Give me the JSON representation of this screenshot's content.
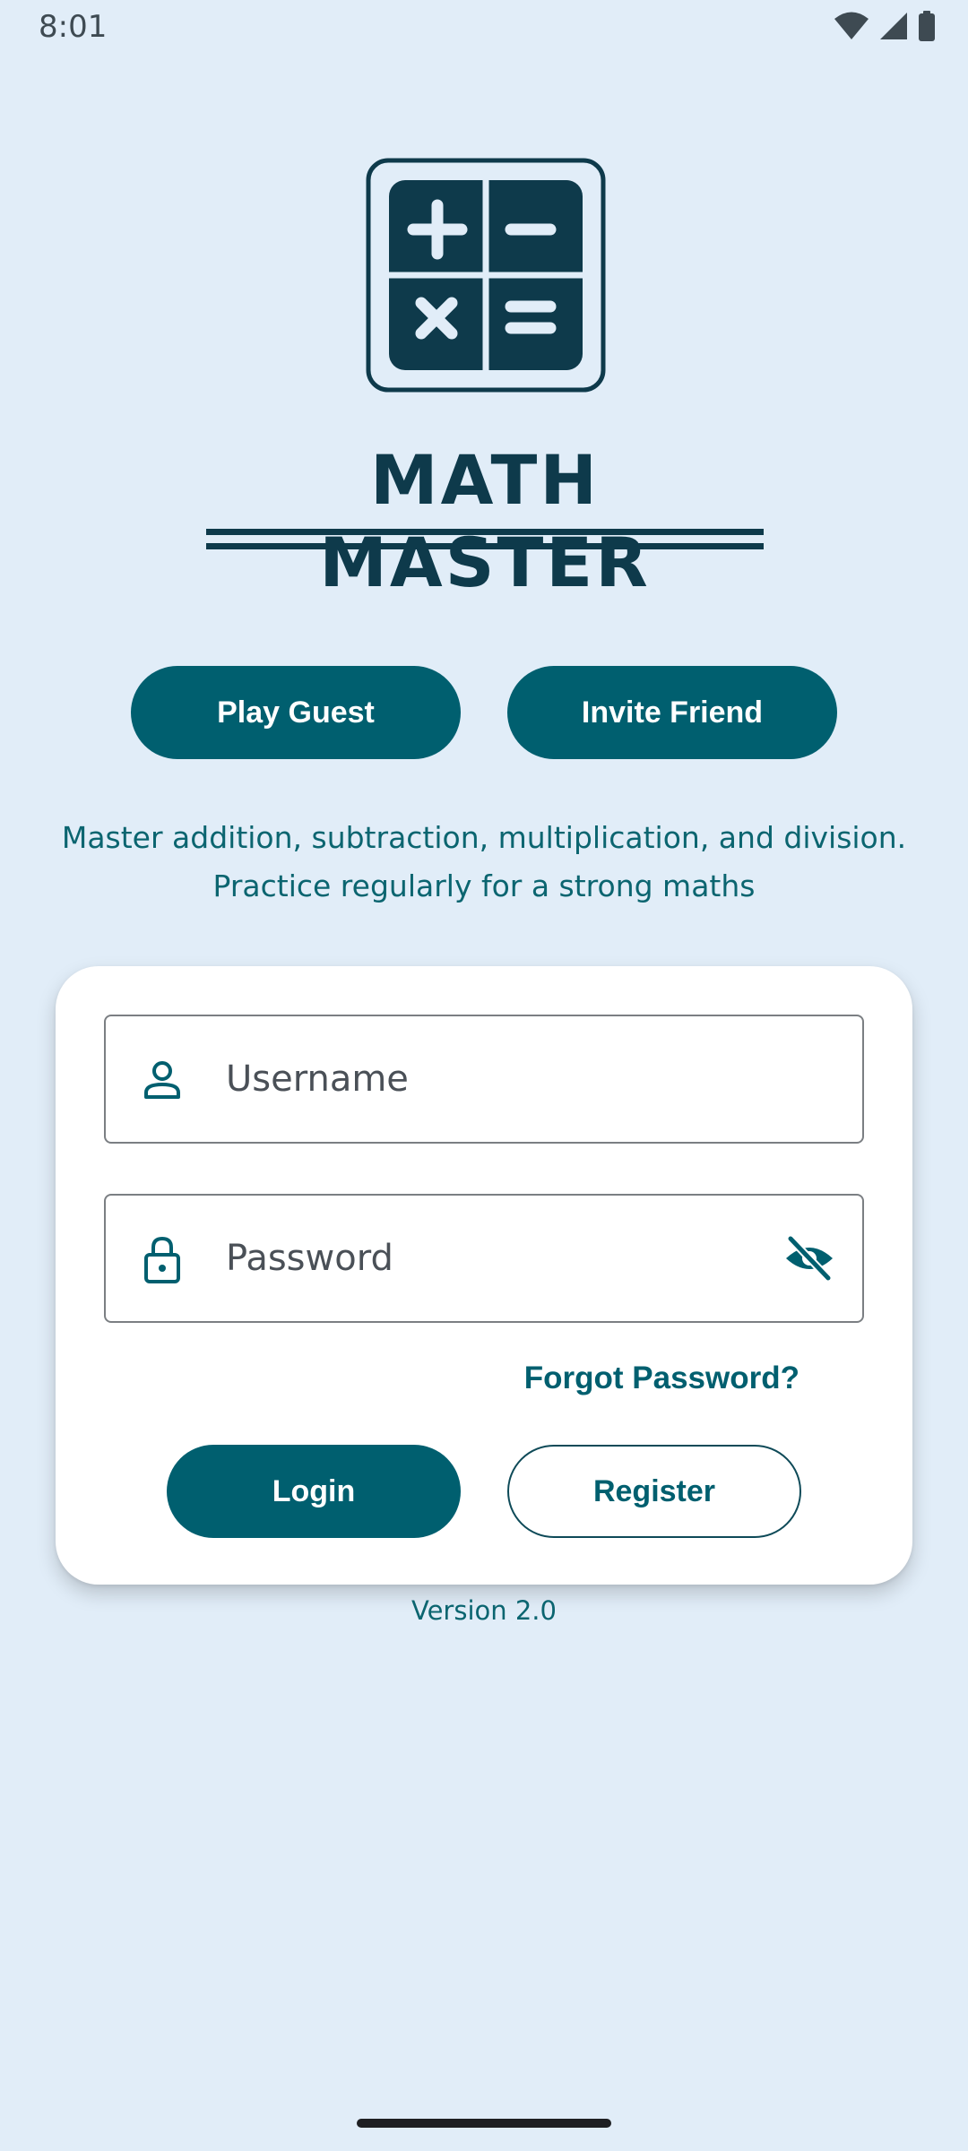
{
  "status_bar": {
    "time": "8:01",
    "icons": [
      "wifi-icon",
      "signal-icon",
      "battery-icon"
    ]
  },
  "app": {
    "title": "MATH MASTER",
    "logo_icon": "calculator-icon"
  },
  "top_actions": {
    "play_guest": "Play Guest",
    "invite_friend": "Invite Friend"
  },
  "tagline": {
    "line1": "Master addition, subtraction, multiplication, and division.",
    "line2": "Practice regularly for a strong maths"
  },
  "login_form": {
    "username": {
      "placeholder": "Username",
      "value": "",
      "icon": "person-icon"
    },
    "password": {
      "placeholder": "Password",
      "value": "",
      "icon": "lock-icon",
      "toggle_icon": "visibility-off-icon"
    },
    "forgot_password": "Forgot Password?",
    "login_label": "Login",
    "register_label": "Register"
  },
  "version": "Version 2.0",
  "colors": {
    "background": "#e1edf8",
    "primary": "#005f6f",
    "title": "#0e3a4b",
    "card": "#ffffff"
  }
}
